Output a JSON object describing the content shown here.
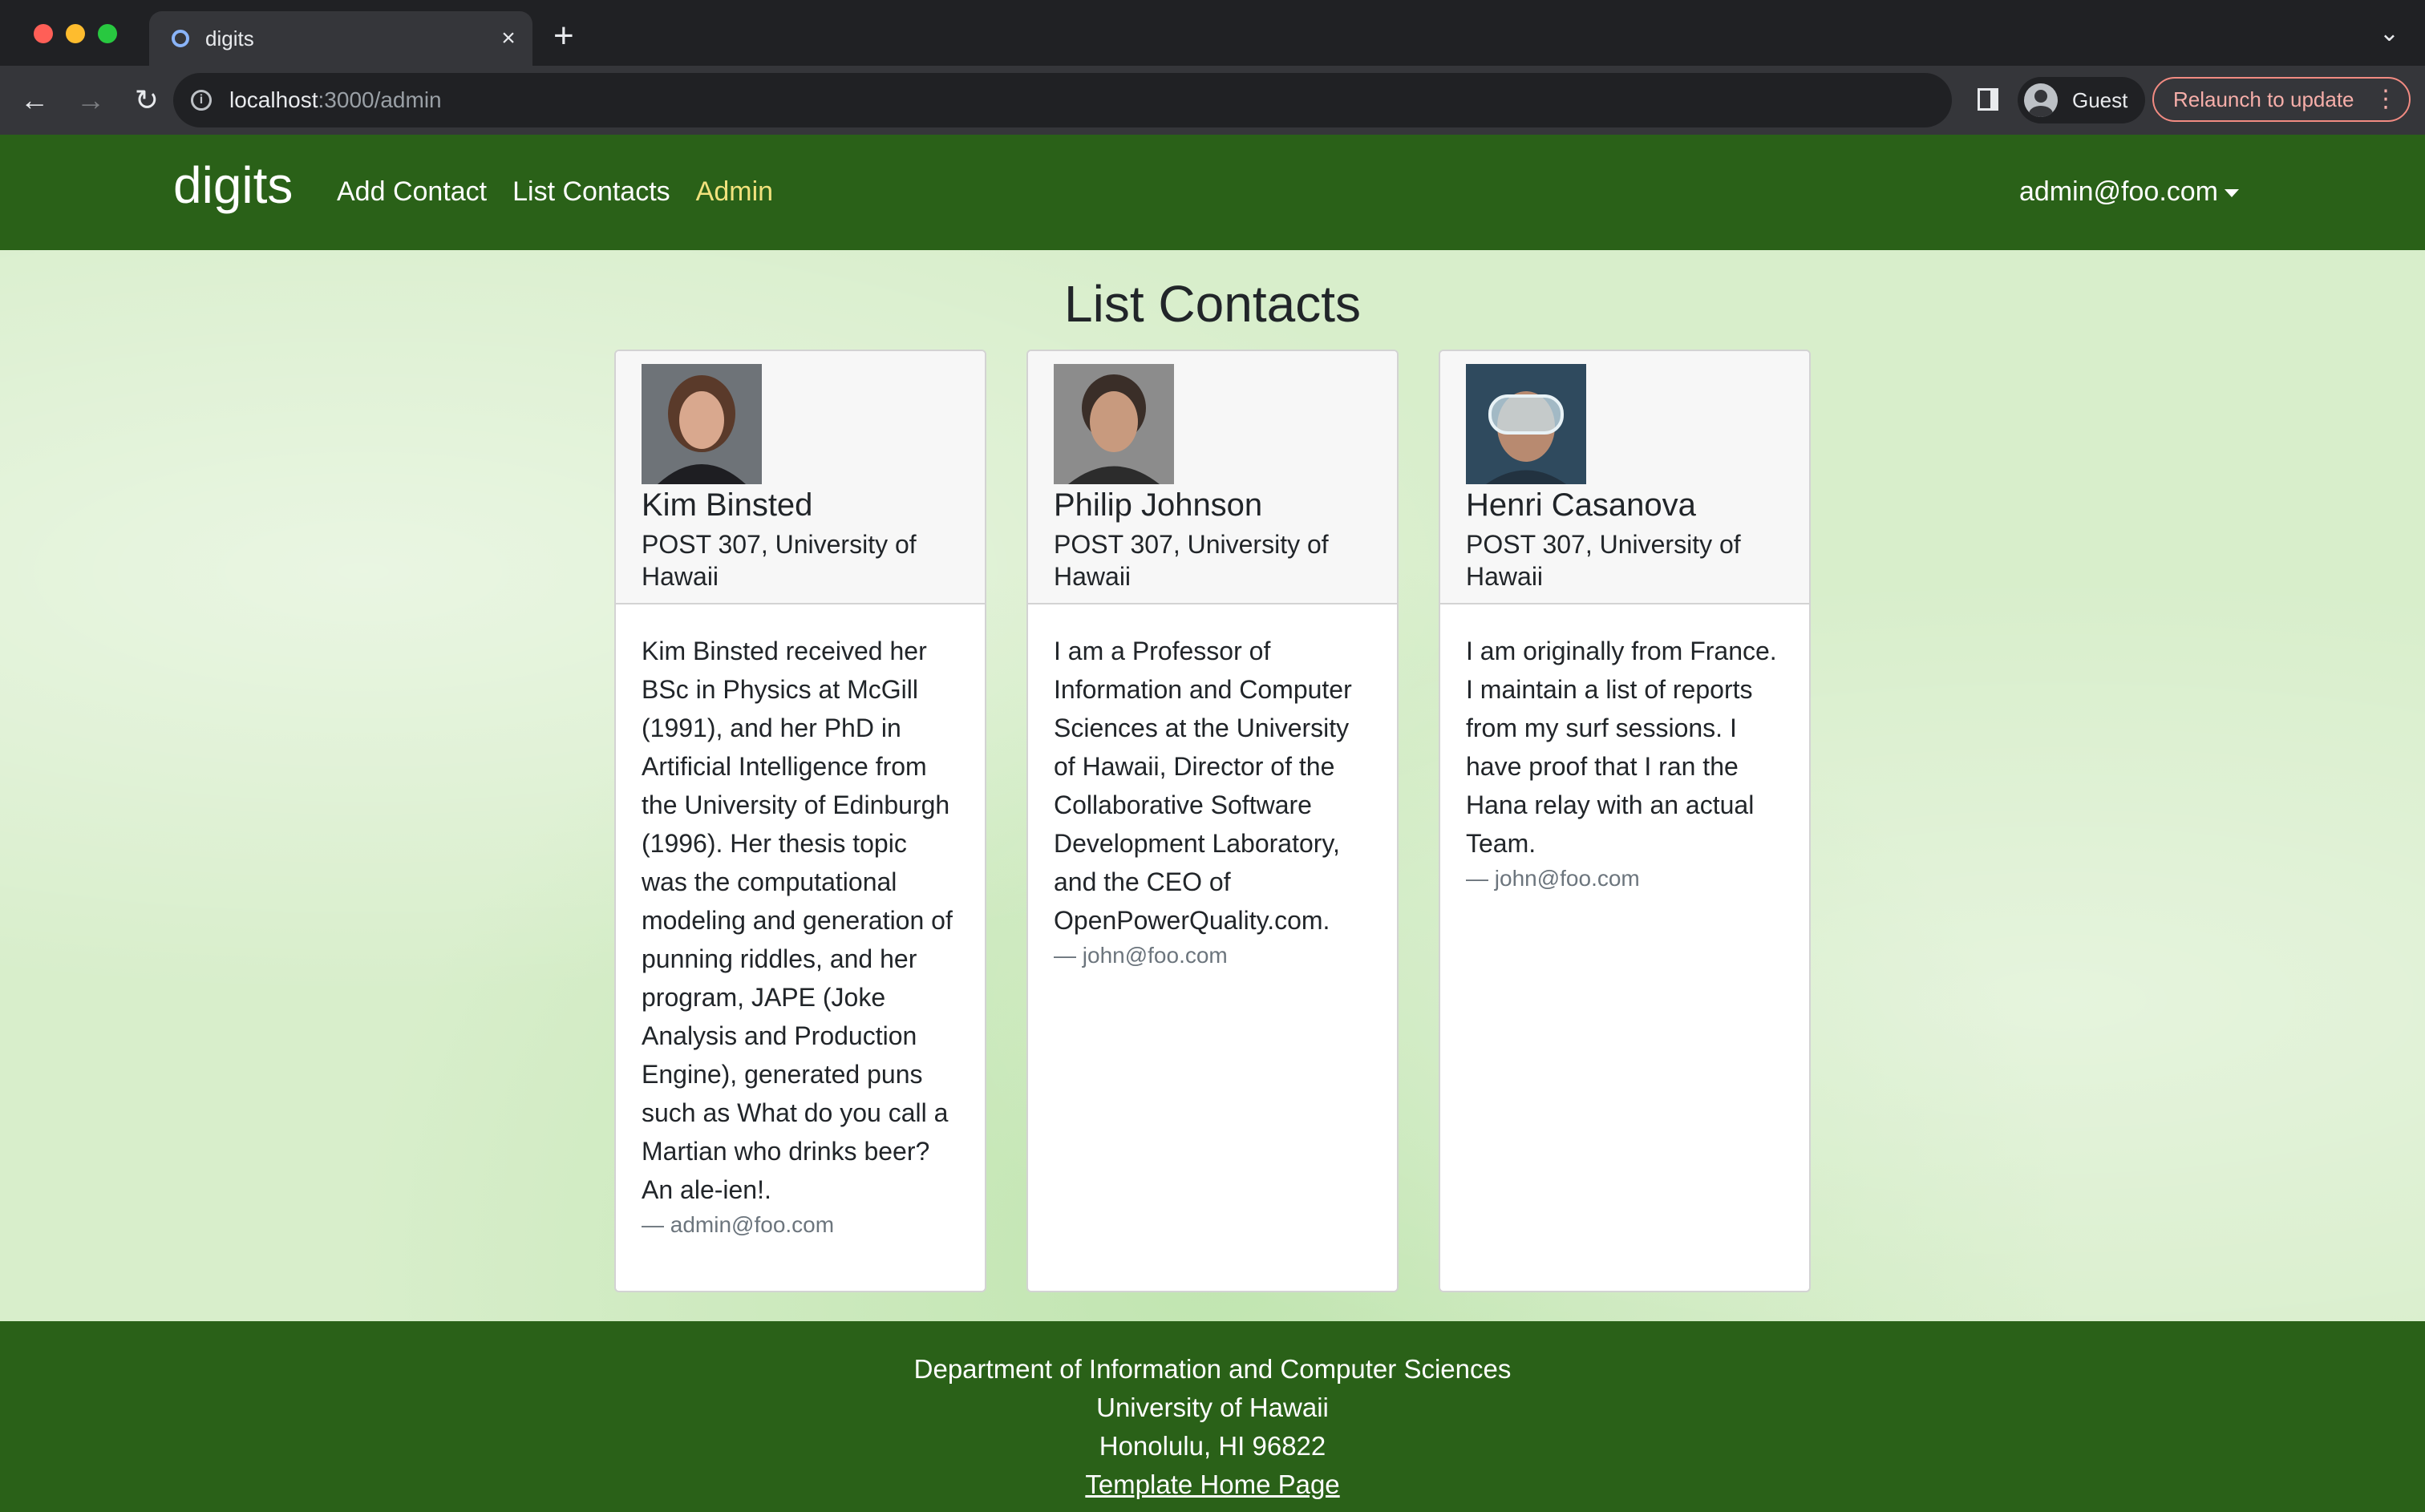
{
  "browser": {
    "tab_title": "digits",
    "url_host": "localhost",
    "url_rest": ":3000/admin",
    "profile_label": "Guest",
    "relaunch_label": "Relaunch to update"
  },
  "navbar": {
    "brand": "digits",
    "links": [
      {
        "label": "Add Contact"
      },
      {
        "label": "List Contacts"
      },
      {
        "label": "Admin"
      }
    ],
    "user_label": "admin@foo.com"
  },
  "page": {
    "title": "List Contacts"
  },
  "contacts": [
    {
      "name": "Kim Binsted",
      "address": "POST 307, University of Hawaii",
      "description": "Kim Binsted received her BSc in Physics at McGill (1991), and her PhD in Artificial Intelligence from the University of Edinburgh (1996). Her thesis topic was the computational modeling and generation of punning riddles, and her program, JAPE (Joke Analysis and Production Engine), generated puns such as What do you call a Martian who drinks beer? An ale-ien!.",
      "owner": "— admin@foo.com"
    },
    {
      "name": "Philip Johnson",
      "address": "POST 307, University of Hawaii",
      "description": "I am a Professor of Information and Computer Sciences at the University of Hawaii, Director of the Collaborative Software Development Laboratory, and the CEO of OpenPowerQuality.com.",
      "owner": "— john@foo.com"
    },
    {
      "name": "Henri Casanova",
      "address": "POST 307, University of Hawaii",
      "description": "I am originally from France. I maintain a list of reports from my surf sessions. I have proof that I ran the Hana relay with an actual Team.",
      "owner": "— john@foo.com"
    }
  ],
  "footer": {
    "line1": "Department of Information and Computer Sciences",
    "line2": "University of Hawaii",
    "line3": "Honolulu, HI 96822",
    "link": "Template Home Page"
  },
  "colors": {
    "navbar_bg": "#2a6118",
    "active_link": "#f2e27d"
  }
}
